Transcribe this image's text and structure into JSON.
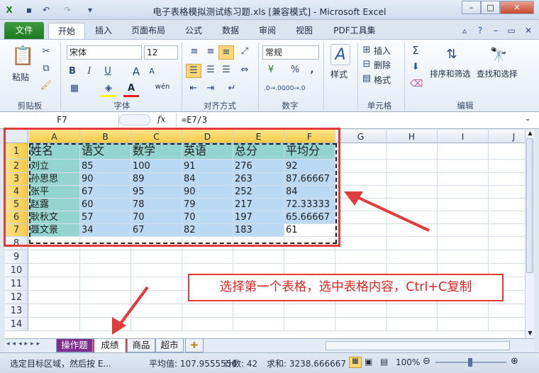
{
  "window": {
    "title": "电子表格模拟测试练习题.xls [兼容模式] - Microsoft Excel",
    "quick_access": [
      "save-icon",
      "undo-icon",
      "redo-icon"
    ]
  },
  "tabs": {
    "file": "文件",
    "items": [
      "开始",
      "插入",
      "页面布局",
      "公式",
      "数据",
      "审阅",
      "视图",
      "PDF工具集"
    ],
    "active": "开始"
  },
  "ribbon": {
    "clipboard": {
      "paste": "粘贴",
      "label": "剪贴板"
    },
    "font": {
      "name": "宋体",
      "size": "12",
      "bold": "B",
      "italic": "I",
      "underline": "U",
      "label": "字体",
      "grow": "A",
      "shrink": "A",
      "wen": "wén"
    },
    "alignment": {
      "label": "对齐方式"
    },
    "number": {
      "format": "常规",
      "percent": "%",
      "comma": ",",
      "label": "数字"
    },
    "styles": {
      "label": "样式"
    },
    "cells": {
      "insert": "插入",
      "delete": "删除",
      "format": "格式",
      "label": "单元格"
    },
    "editing": {
      "sum": "Σ",
      "sort_filter": "排序和筛选",
      "find_select": "查找和选择",
      "label": "编辑"
    }
  },
  "formula_bar": {
    "name_box": "F7",
    "fx": "fx",
    "formula": "=E7/3"
  },
  "grid": {
    "columns": [
      "A",
      "B",
      "C",
      "D",
      "E",
      "F",
      "G",
      "H",
      "I",
      "J"
    ],
    "rows": [
      "1",
      "2",
      "3",
      "4",
      "5",
      "6",
      "7",
      "8",
      "9",
      "10",
      "11",
      "12",
      "13",
      "14"
    ],
    "header": [
      "姓名",
      "语文",
      "数学",
      "英语",
      "总分",
      "平均分"
    ],
    "data": [
      [
        "刘立",
        "85",
        "100",
        "91",
        "276",
        "92"
      ],
      [
        "孙思思",
        "90",
        "89",
        "84",
        "263",
        "87.66667"
      ],
      [
        "张平",
        "67",
        "95",
        "90",
        "252",
        "84"
      ],
      [
        "赵露",
        "60",
        "78",
        "79",
        "217",
        "72.33333"
      ],
      [
        "耿秋文",
        "57",
        "70",
        "70",
        "197",
        "65.66667"
      ],
      [
        "聂文景",
        "34",
        "67",
        "82",
        "183",
        "61"
      ]
    ]
  },
  "sheets": {
    "tabs": [
      "操作题",
      "成绩",
      "商品",
      "超市"
    ],
    "active": "成绩"
  },
  "status": {
    "hint": "选定目标区域，然后按 E...",
    "average": "平均值: 107.9555556",
    "count": "计数: 42",
    "sum": "求和: 3238.666667",
    "zoom": "100%"
  },
  "annotation": "选择第一个表格，选中表格内容，Ctrl+C复制",
  "colors": {
    "accent_red": "#e23b3b",
    "header_fill": "#93d4d0",
    "data_fill": "#bcd9f4",
    "file_tab": "#1e7b22"
  }
}
